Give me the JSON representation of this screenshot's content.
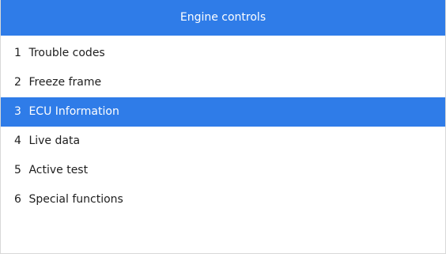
{
  "header": {
    "title": "Engine controls"
  },
  "menu": {
    "items": [
      {
        "number": "1",
        "label": "Trouble codes",
        "selected": false
      },
      {
        "number": "2",
        "label": "Freeze frame",
        "selected": false
      },
      {
        "number": "3",
        "label": "ECU Information",
        "selected": true
      },
      {
        "number": "4",
        "label": "Live data",
        "selected": false
      },
      {
        "number": "5",
        "label": "Active test",
        "selected": false
      },
      {
        "number": "6",
        "label": "Special functions",
        "selected": false
      }
    ]
  },
  "colors": {
    "header_bg": "#2f7ce8",
    "selected_bg": "#2f7ce8",
    "text": "#1e1e1e",
    "selected_text": "#ffffff"
  }
}
